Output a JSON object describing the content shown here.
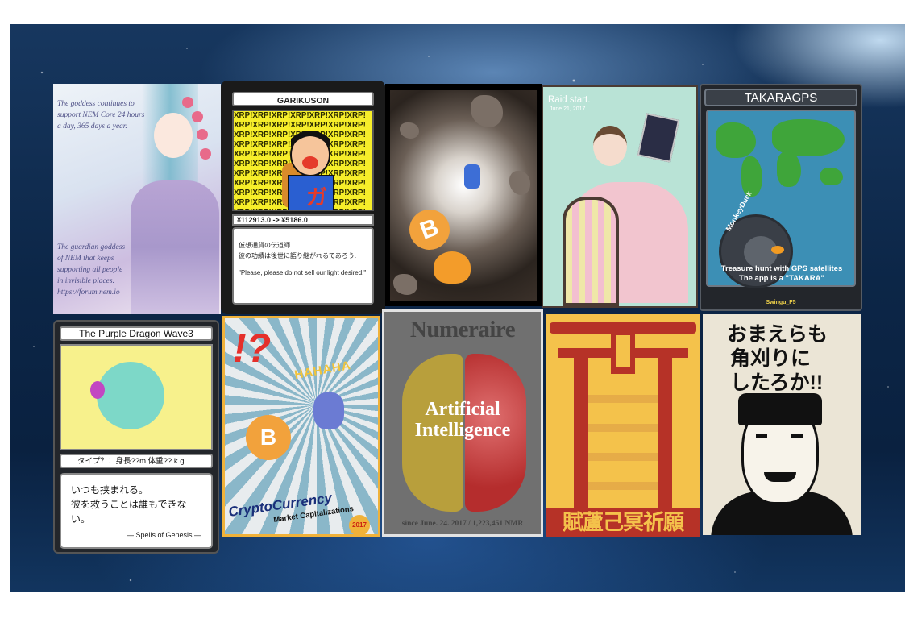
{
  "cards": {
    "nem": {
      "verse_top": "The goddess continues to support NEM Core 24 hours a day, 365 days a year.",
      "verse_bottom": "The guardian goddess of NEM that keeps supporting all people in invisible places. https://forum.nem.io"
    },
    "garikuson": {
      "name": "GARIKUSON",
      "pattern": "XRP!XRP!XRP!XRP!XRP!XRP!XRP!",
      "art_char": "ガ",
      "price": "¥112913.0 -> ¥5186.0",
      "desc_line1": "仮想通貨の伝道師.",
      "desc_line2": "彼の功績は後世に語り継がれるであろう.",
      "quote": "\"Please, please do not sell our light desired.\""
    },
    "bitcoin_blast": {
      "coin_symbol": "B"
    },
    "raid": {
      "title": "Raid start.",
      "date": "June 21, 2017"
    },
    "takaragps": {
      "title": "TAKARAGPS",
      "duck_label": "MonkeyDuck",
      "desc_line1": "Treasure hunt with GPS satellites",
      "desc_line2": "The app is a \"TAKARA\"",
      "author": "Swingu_F5"
    },
    "purple_dragon": {
      "name": "The Purple Dragon Wave3",
      "stat": "タイプ？：身長??m 体重?? k g",
      "desc_line1": "いつも挟まれる。",
      "desc_line2": "彼を救うことは誰もできない。",
      "signature": "— Spells of Genesis —"
    },
    "cryptocurrency": {
      "bang": "!?",
      "haha": "HAHAHA",
      "coin_symbol": "B",
      "title": "CryptoCurrency",
      "subtitle": "Market Capitalizations",
      "year": "2017"
    },
    "numeraire": {
      "title": "Numeraire",
      "line1": "Artificial",
      "line2": "Intelligence",
      "since": "since June. 24. 2017 / 1,223,451 NMR"
    },
    "torii": {
      "bottom_text": "賦蘆己冥祈願"
    },
    "kakugari": {
      "line1": "おまえらも",
      "line2": "角刈りに",
      "line3": "したろか!!"
    }
  },
  "colors": {
    "space_bg": "#0c2647",
    "xrp_yellow": "#f6ee2a",
    "bitcoin_orange": "#f2a23c",
    "torii_red": "#b63227",
    "torii_yellow": "#f4c24b"
  }
}
